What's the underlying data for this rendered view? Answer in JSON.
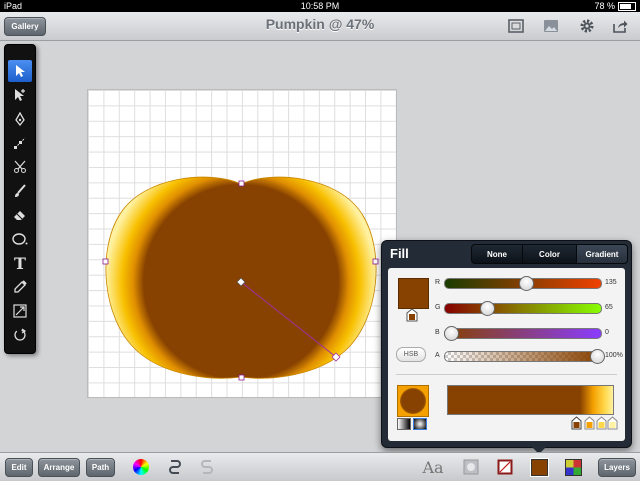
{
  "status": {
    "device": "iPad",
    "time": "10:58 PM",
    "battery": "78 %"
  },
  "titlebar": {
    "gallery_label": "Gallery",
    "title": "Pumpkin @ 47%"
  },
  "tools": [
    "select",
    "subselect",
    "pen",
    "add-anchor",
    "scissors",
    "brush",
    "eraser",
    "ellipse",
    "text",
    "eyedropper",
    "transform",
    "rotate"
  ],
  "fill_panel": {
    "title": "Fill",
    "tabs": [
      "None",
      "Color",
      "Gradient"
    ],
    "selected_tab": "Gradient",
    "swatch_color": "#874100",
    "sliders": [
      {
        "label": "R",
        "value": "135",
        "fraction": 0.53
      },
      {
        "label": "G",
        "value": "65",
        "fraction": 0.25
      },
      {
        "label": "B",
        "value": "0",
        "fraction": 0.0
      },
      {
        "label": "A",
        "value": "100%",
        "fraction": 1.0
      }
    ],
    "hsb_label": "HSB",
    "gradient_stops": [
      "#874100",
      "#f4a000",
      "#ffd84a",
      "#fff6a0"
    ]
  },
  "bottombar": {
    "edit_label": "Edit",
    "arrange_label": "Arrange",
    "path_label": "Path",
    "layers_label": "Layers",
    "font_label": "Aa"
  },
  "colors": {
    "fill": "#874100",
    "gold": "#f4b000",
    "popover": "#232b36"
  }
}
